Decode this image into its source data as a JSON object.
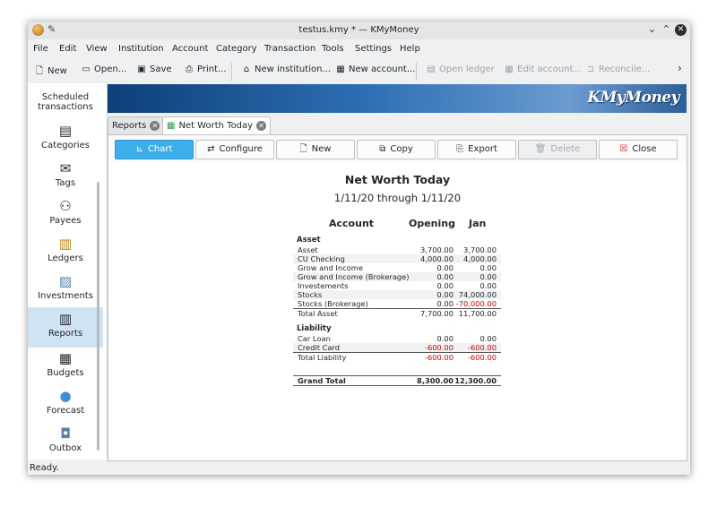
{
  "window": {
    "title": "testus.kmy * — KMyMoney"
  },
  "menu": [
    "File",
    "Edit",
    "View",
    "Institution",
    "Account",
    "Category",
    "Transaction",
    "Tools",
    "Settings",
    "Help"
  ],
  "toolbar": {
    "new": "New",
    "open": "Open...",
    "save": "Save",
    "print": "Print...",
    "new_institution": "New institution...",
    "new_account": "New account...",
    "open_ledger": "Open ledger",
    "edit_account": "Edit account...",
    "reconcile": "Reconcile..."
  },
  "sidebar": {
    "items": [
      "Scheduled transactions",
      "Categories",
      "Tags",
      "Payees",
      "Ledgers",
      "Investments",
      "Reports",
      "Budgets",
      "Forecast",
      "Outbox"
    ],
    "active": "Reports"
  },
  "banner": {
    "logo": "KMyMoney"
  },
  "tabs": [
    {
      "label": "Reports"
    },
    {
      "label": "Net Worth Today"
    }
  ],
  "report_buttons": {
    "chart": "Chart",
    "configure": "Configure",
    "new": "New",
    "copy": "Copy",
    "export": "Export",
    "delete": "Delete",
    "close": "Close"
  },
  "report": {
    "title": "Net Worth Today",
    "subtitle": "1/11/20 through 1/11/20",
    "columns": [
      "Account",
      "Opening",
      "Jan"
    ],
    "asset_label": "Asset",
    "assets": [
      [
        "Asset",
        "3,700.00",
        "3,700.00"
      ],
      [
        "CU Checking",
        "4,000.00",
        "4,000.00"
      ],
      [
        "Grow and Income",
        "0.00",
        "0.00"
      ],
      [
        "Grow and Income (Brokerage)",
        "0.00",
        "0.00"
      ],
      [
        "Investements",
        "0.00",
        "0.00"
      ],
      [
        "Stocks",
        "0.00",
        "74,000.00"
      ],
      [
        "Stocks (Brokerage)",
        "0.00",
        "-70,000.00"
      ]
    ],
    "total_asset": [
      "Total Asset",
      "7,700.00",
      "11,700.00"
    ],
    "liability_label": "Liability",
    "liabilities": [
      [
        "Car Loan",
        "0.00",
        "0.00"
      ],
      [
        "Credit Card",
        "-600.00",
        "-600.00"
      ]
    ],
    "total_liability": [
      "Total Liability",
      "-600.00",
      "-600.00"
    ],
    "grand_total": [
      "Grand Total",
      "8,300.00",
      "12,300.00"
    ]
  },
  "status": {
    "text": "Ready."
  }
}
